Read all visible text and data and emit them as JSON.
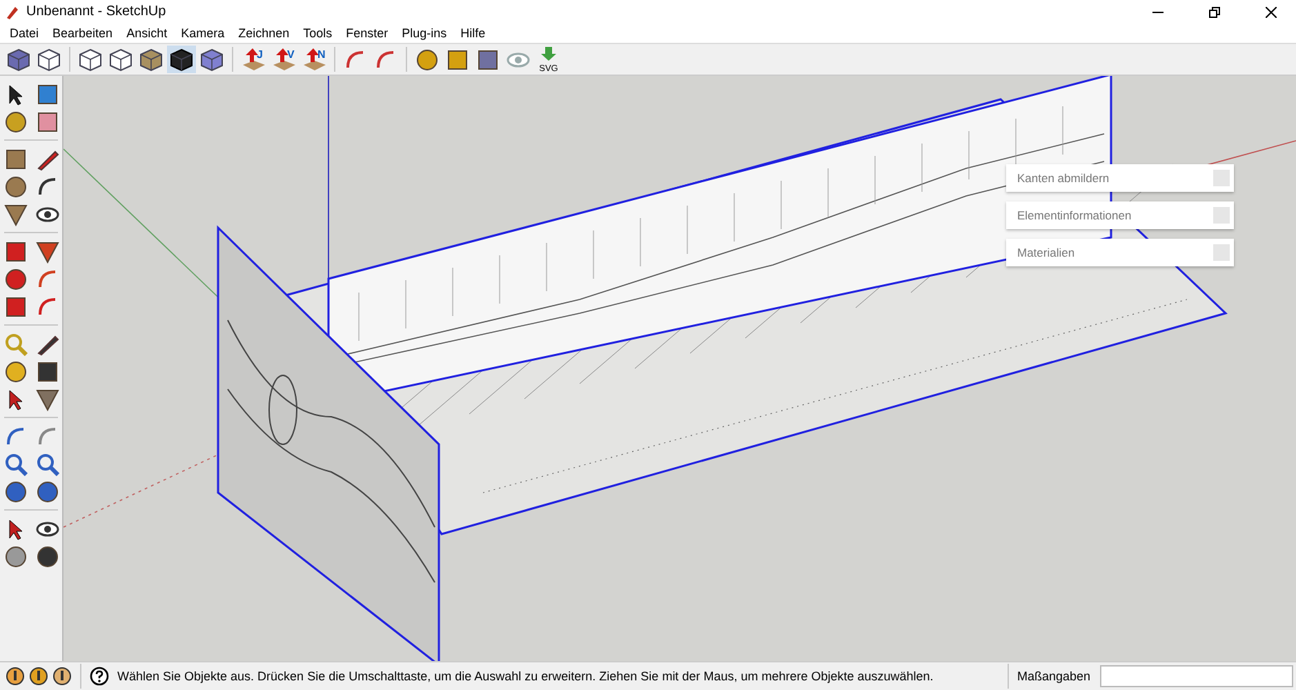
{
  "window": {
    "title": "Unbenannt - SketchUp"
  },
  "menu": [
    "Datei",
    "Bearbeiten",
    "Ansicht",
    "Kamera",
    "Zeichnen",
    "Tools",
    "Fenster",
    "Plug-ins",
    "Hilfe"
  ],
  "toolbar": {
    "badges": [
      "J",
      "V",
      "N"
    ],
    "svg_label": "SVG"
  },
  "trays": [
    {
      "title": "Kanten abmildern"
    },
    {
      "title": "Elementinformationen"
    },
    {
      "title": "Materialien"
    }
  ],
  "status_bar": {
    "hint": "Wählen Sie Objekte aus. Drücken Sie die Umschalttaste, um die Auswahl zu erweitern. Ziehen Sie mit der Maus, um mehrere Objekte auszuwählen.",
    "measure_label": "Maßangaben"
  }
}
